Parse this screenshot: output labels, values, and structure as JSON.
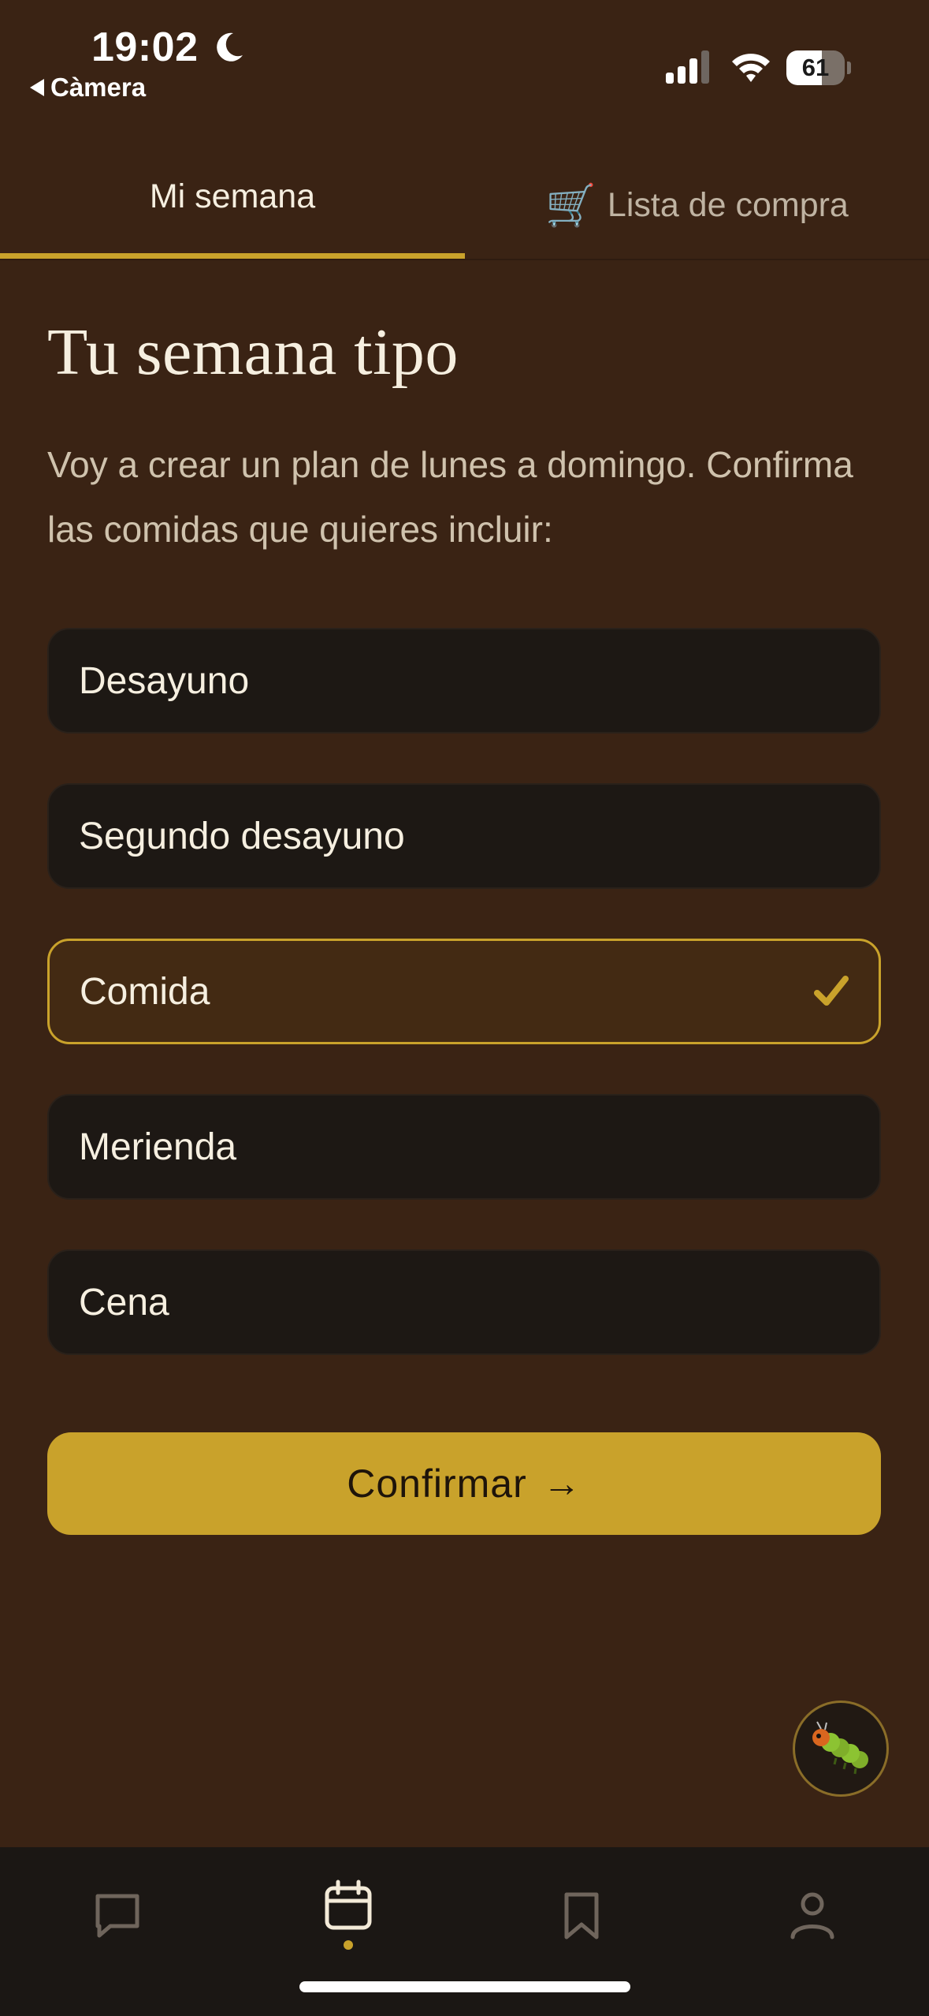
{
  "status_bar": {
    "time": "19:02",
    "back_app": "Càmera",
    "battery_level": 61,
    "battery_text": "61"
  },
  "tabs": [
    {
      "label": "Mi semana",
      "active": true
    },
    {
      "label": "Lista de compra",
      "icon": "shopping-cart-icon",
      "active": false
    }
  ],
  "page": {
    "title": "Tu semana tipo",
    "intro": "Voy a crear un plan de lunes a domingo. Confirma las comidas que quieres incluir:"
  },
  "meals": [
    {
      "label": "Desayuno",
      "selected": false
    },
    {
      "label": "Segundo desayuno",
      "selected": false
    },
    {
      "label": "Comida",
      "selected": true
    },
    {
      "label": "Merienda",
      "selected": false
    },
    {
      "label": "Cena",
      "selected": false
    }
  ],
  "confirm_button": {
    "label": "Confirmar",
    "arrow": "→"
  },
  "bottom_nav": [
    {
      "icon": "chat-icon",
      "active": false
    },
    {
      "icon": "calendar-icon",
      "active": true
    },
    {
      "icon": "bookmark-icon",
      "active": false
    },
    {
      "icon": "profile-icon",
      "active": false
    }
  ],
  "colors": {
    "background": "#3a2314",
    "accent": "#c9a22b",
    "card": "#1d1814",
    "selected_card": "#432a13",
    "nav_background": "#1b1714"
  }
}
